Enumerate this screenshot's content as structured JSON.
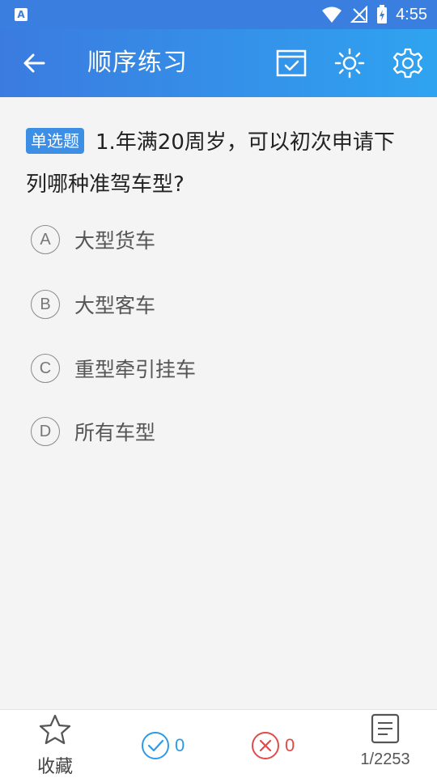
{
  "status_bar": {
    "time": "4:55",
    "app_indicator": "A"
  },
  "app_bar": {
    "title": "顺序练习",
    "icons": [
      "back-arrow-icon",
      "answer-sheet-icon",
      "brightness-icon",
      "settings-icon"
    ]
  },
  "question": {
    "type_badge": "单选题",
    "text": "1.年满20周岁，可以初次申请下列哪种准驾车型?",
    "options": [
      {
        "letter": "A",
        "text": "大型货车"
      },
      {
        "letter": "B",
        "text": "大型客车"
      },
      {
        "letter": "C",
        "text": "重型牵引挂车"
      },
      {
        "letter": "D",
        "text": "所有车型"
      }
    ]
  },
  "bottom_bar": {
    "favorite_label": "收藏",
    "correct_count": "0",
    "wrong_count": "0",
    "progress": "1/2253"
  },
  "colors": {
    "accent": "#3b7be0",
    "correct": "#2e9ae6",
    "wrong": "#e24a4a"
  }
}
